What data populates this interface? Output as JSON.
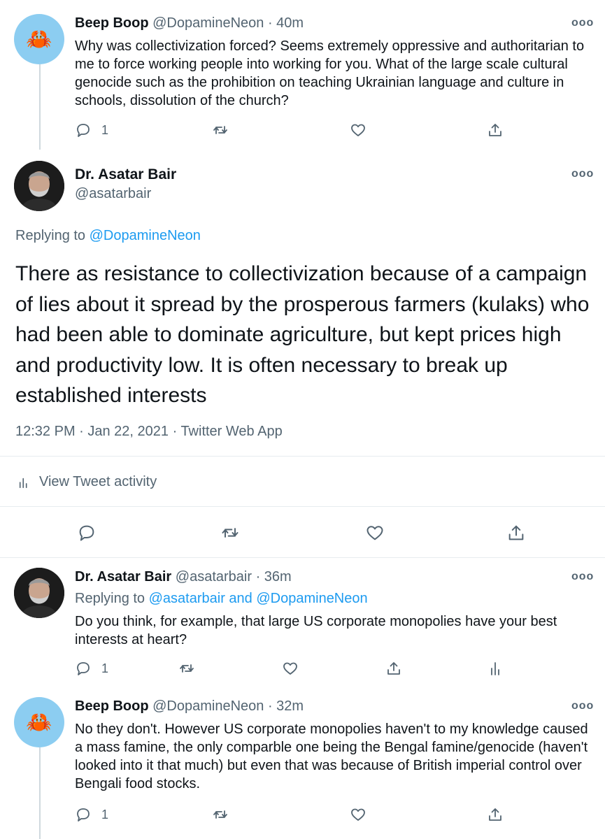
{
  "tweets": [
    {
      "name": "Beep Boop",
      "handle": "@DopamineNeon",
      "time": "· 40m",
      "text": "Why was collectivization forced? Seems extremely oppressive and authoritarian to me to force working people into working for you. What of the large scale cultural genocide such as the prohibition on teaching Ukrainian language and culture in schools, dissolution of the church?",
      "reply_count": "1"
    },
    {
      "name": "Dr. Asatar Bair",
      "handle": "@asatarbair",
      "time": "· 36m",
      "replying_prefix": "Replying to",
      "replying_to": "@asatarbair and @DopamineNeon",
      "text": "Do you think, for example, that large US corporate monopolies have your best interests at heart?",
      "reply_count": "1"
    },
    {
      "name": "Beep Boop",
      "handle": "@DopamineNeon",
      "time": "· 32m",
      "text": "No they don't. However US corporate monopolies haven't to my knowledge caused a mass famine, the only comparble one being the Bengal famine/genocide (haven't looked into it that much) but even that was because of British imperial control over Bengali food stocks.",
      "reply_count": "1"
    }
  ],
  "main": {
    "name": "Dr. Asatar Bair",
    "handle": "@asatarbair",
    "replying_prefix": "Replying to",
    "replying_to": "@DopamineNeon",
    "text": "There as resistance to collectivization because of a campaign of lies about it spread by the prosperous farmers (kulaks) who had been able to dominate agriculture, but kept prices high and productivity low. It is often necessary to break up established interests",
    "timestamp": "12:32 PM · Jan 22, 2021 · Twitter Web App",
    "activity_label": "View Tweet activity"
  },
  "more_glyph": "ooo",
  "colors": {
    "link": "#1d9bf0",
    "muted": "#536471",
    "thread_line": "#cfd9de"
  }
}
